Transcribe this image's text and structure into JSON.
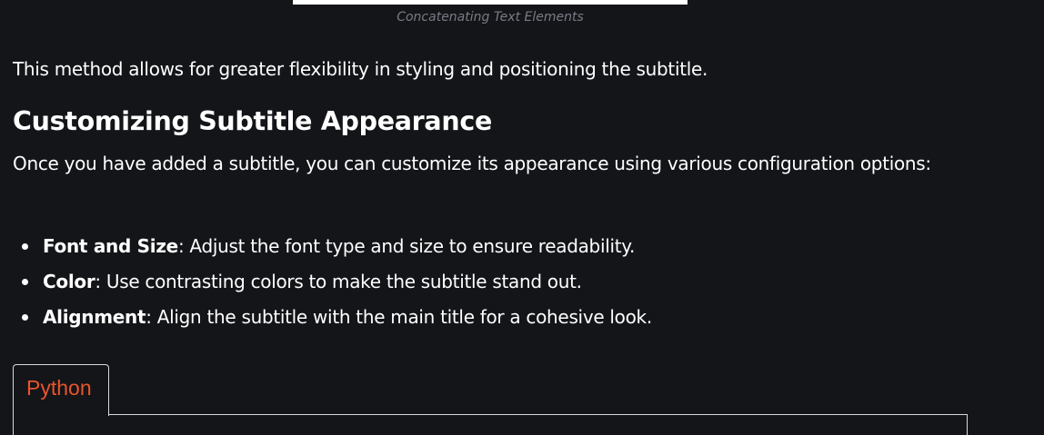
{
  "figure": {
    "caption": "Concatenating Text Elements"
  },
  "content": {
    "paragraph1": "This method allows for greater flexibility in styling and positioning the subtitle.",
    "heading": "Customizing Subtitle Appearance",
    "paragraph2": "Once you have added a subtitle, you can customize its appearance using various configuration options:",
    "bullets": [
      {
        "term": "Font and Size",
        "text": ": Adjust the font type and size to ensure readability."
      },
      {
        "term": "Color",
        "text": ": Use contrasting colors to make the subtitle stand out."
      },
      {
        "term": "Alignment",
        "text": ": Align the subtitle with the main title for a cohesive look."
      }
    ]
  },
  "code_tabs": {
    "tabs": [
      {
        "label": "Python",
        "active": true
      }
    ]
  },
  "colors": {
    "background": "#141519",
    "text": "#ffffff",
    "caption": "#787c84",
    "tab_accent": "#e8552b",
    "border": "#d9d9d9"
  }
}
